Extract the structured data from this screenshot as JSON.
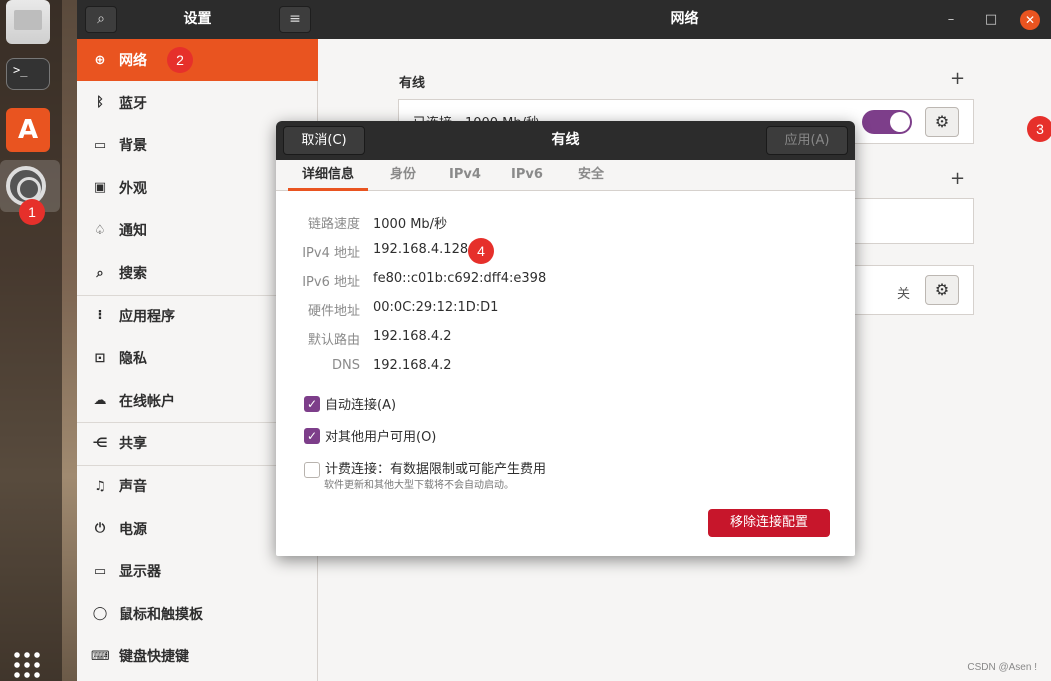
{
  "dock": {
    "terminal_label": ">_",
    "markers": [
      "1"
    ]
  },
  "settings": {
    "title": "设置",
    "panel_title": "网络",
    "sidebar": [
      {
        "label": "网络",
        "icon": "network-icon",
        "glyph": "⊕",
        "active": true
      },
      {
        "label": "蓝牙",
        "icon": "bluetooth-icon",
        "glyph": "ᛒ"
      },
      {
        "label": "背景",
        "icon": "background-icon",
        "glyph": "▭"
      },
      {
        "label": "外观",
        "icon": "appearance-icon",
        "glyph": "▣"
      },
      {
        "label": "通知",
        "icon": "bell-icon",
        "glyph": "♤"
      },
      {
        "label": "搜索",
        "icon": "search-icon",
        "glyph": "⌕"
      },
      {
        "label": "应用程序",
        "icon": "apps-icon",
        "glyph": "⁝"
      },
      {
        "label": "隐私",
        "icon": "lock-icon",
        "glyph": "⊡"
      },
      {
        "label": "在线帐户",
        "icon": "cloud-icon",
        "glyph": "☁"
      },
      {
        "label": "共享",
        "icon": "share-icon",
        "glyph": "⋲"
      },
      {
        "label": "声音",
        "icon": "music-icon",
        "glyph": "♫"
      },
      {
        "label": "电源",
        "icon": "power-icon",
        "glyph": "⏻"
      },
      {
        "label": "显示器",
        "icon": "display-icon",
        "glyph": "▭"
      },
      {
        "label": "鼠标和触摸板",
        "icon": "mouse-icon",
        "glyph": "◯"
      },
      {
        "label": "键盘快捷键",
        "icon": "keyboard-icon",
        "glyph": "⌨"
      }
    ],
    "wired_section": {
      "title": "有线",
      "plus": "+",
      "row_text": "已连接 - 1000 Mb/秒"
    },
    "second_section": {
      "plus": "+"
    },
    "proxy_row": {
      "state": "关"
    },
    "markers": {
      "sidebar": "2",
      "gear": "3"
    }
  },
  "dialog": {
    "cancel": "取消(C)",
    "title": "有线",
    "apply": "应用(A)",
    "tabs": [
      "详细信息",
      "身份",
      "IPv4",
      "IPv6",
      "安全"
    ],
    "details": [
      {
        "label": "链路速度",
        "value": "1000 Mb/秒"
      },
      {
        "label": "IPv4 地址",
        "value": "192.168.4.128"
      },
      {
        "label": "IPv6 地址",
        "value": "fe80::c01b:c692:dff4:e398"
      },
      {
        "label": "硬件地址",
        "value": "00:0C:29:12:1D:D1"
      },
      {
        "label": "默认路由",
        "value": "192.168.4.2"
      },
      {
        "label": "DNS",
        "value": "192.168.4.2"
      }
    ],
    "auto_connect": {
      "label": "自动连接(A)",
      "checked": true
    },
    "available_to_all": {
      "label": "对其他用户可用(O)",
      "checked": true
    },
    "metered": {
      "label": "计费连接：有数据限制或可能产生费用",
      "sub": "软件更新和其他大型下载将不会自动启动。",
      "checked": false
    },
    "remove": "移除连接配置",
    "marker_ipv4": "4"
  },
  "watermark": "CSDN @Asen !",
  "colors": {
    "accent": "#e95420",
    "toggle": "#7d3e8a",
    "danger": "#c7162b",
    "marker": "#e6302b"
  }
}
